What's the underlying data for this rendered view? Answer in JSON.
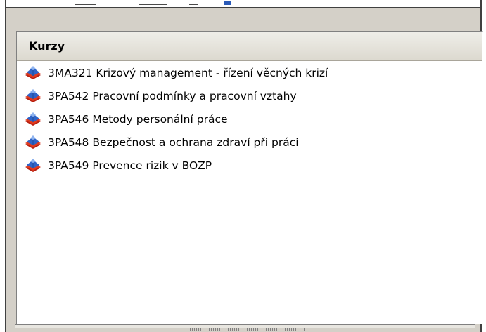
{
  "panel": {
    "header": "Kurzy",
    "items": [
      {
        "label": "3MA321 Krizový management - řízení věcných krizí",
        "icon": "course-icon"
      },
      {
        "label": "3PA542 Pracovní podmínky a pracovní vztahy",
        "icon": "course-icon"
      },
      {
        "label": "3PA546 Metody personální práce",
        "icon": "course-icon"
      },
      {
        "label": "3PA548 Bezpečnost a ochrana zdraví při práci",
        "icon": "course-icon"
      },
      {
        "label": "3PA549 Prevence rizik v BOZP",
        "icon": "course-icon"
      }
    ]
  },
  "colors": {
    "panel_background": "#d4d0c8",
    "list_background": "#ffffff",
    "header_background": "#e6e4dc",
    "icon_blue": "#2f64c8",
    "icon_red": "#d83018"
  }
}
